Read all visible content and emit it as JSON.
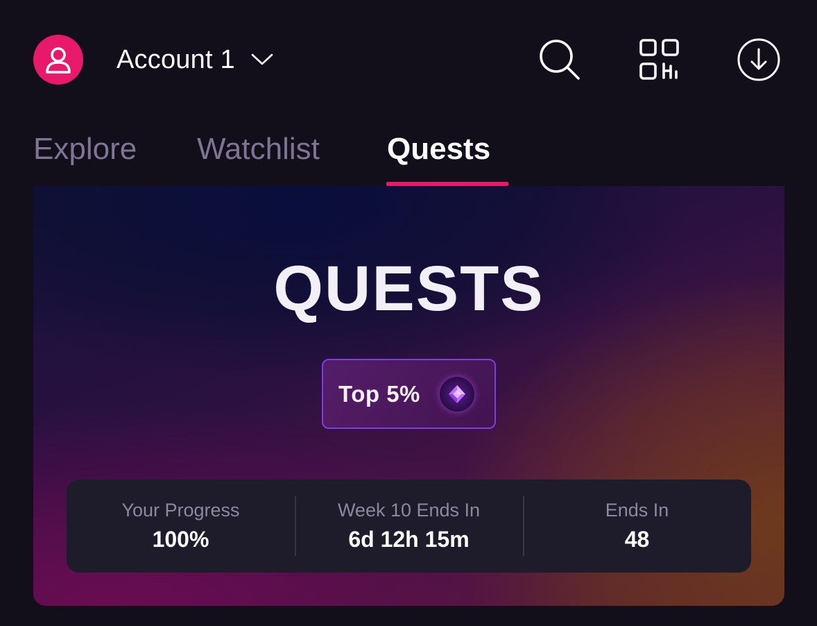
{
  "header": {
    "account_name": "Account 1",
    "avatar_icon": "user-icon",
    "actions": [
      {
        "name": "search",
        "icon": "search-icon"
      },
      {
        "name": "scan-qr",
        "icon": "qr-code-icon"
      },
      {
        "name": "download",
        "icon": "download-circle-icon"
      }
    ]
  },
  "tabs": {
    "explore": "Explore",
    "watchlist": "Watchlist",
    "quests": "Quests",
    "active": "Quests"
  },
  "hero": {
    "title": "QUESTS",
    "rank_label": "Top 5%",
    "rank_icon": "gem-icon",
    "stats": [
      {
        "label": "Your Progress",
        "value": "100%"
      },
      {
        "label": "Week 10 Ends In",
        "value": "6d 12h 15m"
      },
      {
        "label": "Ends In",
        "value": "48"
      }
    ]
  },
  "colors": {
    "accent": "#e8196b",
    "background": "#120f1a",
    "badge_border": "#7b3fe0",
    "stats_panel": "#1e1b2b",
    "inactive_tab": "#7d7593"
  }
}
